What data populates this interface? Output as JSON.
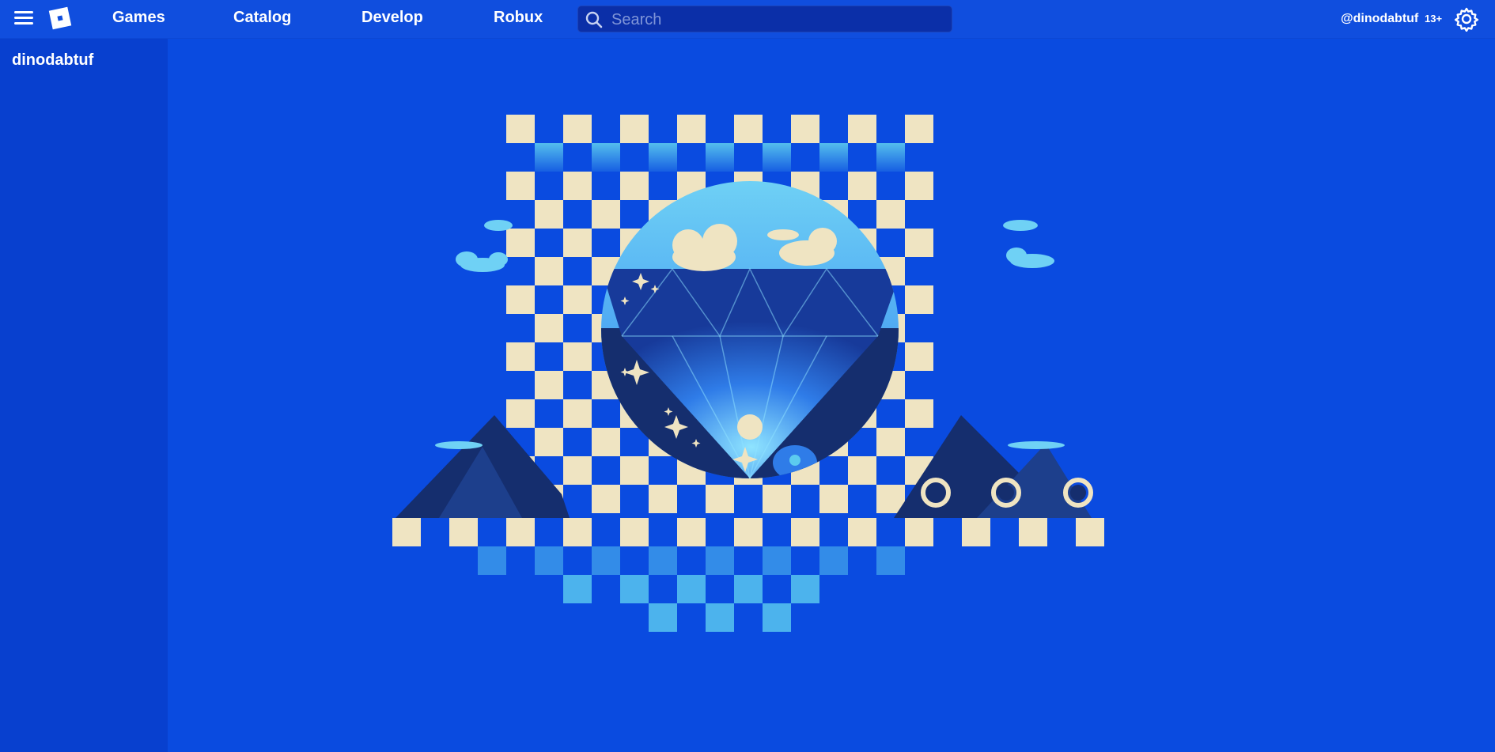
{
  "header": {
    "menu_icon": "hamburger-menu-icon",
    "logo_icon": "roblox-logo-icon",
    "nav": {
      "games": "Games",
      "catalog": "Catalog",
      "develop": "Develop",
      "robux": "Robux"
    },
    "search": {
      "placeholder": "Search",
      "value": "",
      "icon": "search-icon"
    },
    "username": "@dinodabtuf",
    "age_badge": "13+",
    "settings_icon": "gear-icon"
  },
  "sidebar": {
    "user": "dinodabtuf"
  },
  "colors": {
    "background": "#0a4be0",
    "topbar": "#104ede",
    "sidebar": "#0840cf",
    "search_bg": "#0b2fa8",
    "cream": "#efe4c2",
    "light_blue": "#5ccbef",
    "navy": "#152e6e"
  }
}
